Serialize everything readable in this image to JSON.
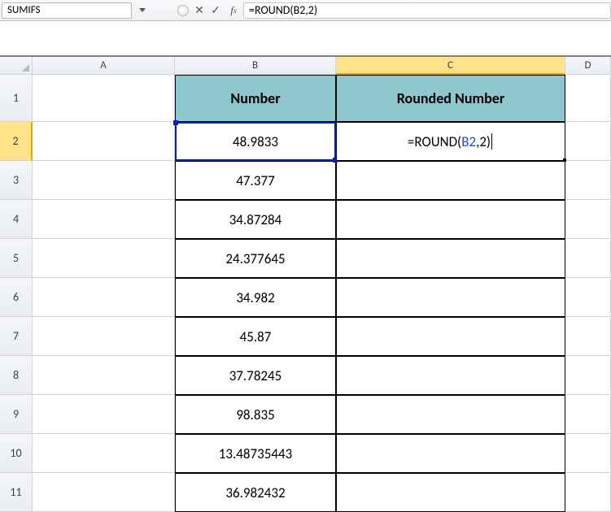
{
  "nameBox": "SUMIFS",
  "formulaBar": "=ROUND(B2,2)",
  "columns": [
    "A",
    "B",
    "C",
    "D"
  ],
  "rows": [
    "1",
    "2",
    "3",
    "4",
    "5",
    "6",
    "7",
    "8",
    "9",
    "10",
    "11"
  ],
  "headers": {
    "B1": "Number",
    "C1": "Rounded Number"
  },
  "editing": {
    "cell": "C2",
    "prefix": "=ROUND(",
    "ref": "B2",
    "suffix": ",2)"
  },
  "chart_data": {
    "type": "table",
    "title": "Number",
    "columns": [
      "Number",
      "Rounded Number"
    ],
    "rows": [
      {
        "Number": 48.9833,
        "Rounded Number": "=ROUND(B2,2)"
      },
      {
        "Number": 47.377,
        "Rounded Number": ""
      },
      {
        "Number": 34.87284,
        "Rounded Number": ""
      },
      {
        "Number": 24.377645,
        "Rounded Number": ""
      },
      {
        "Number": 34.982,
        "Rounded Number": ""
      },
      {
        "Number": 45.87,
        "Rounded Number": ""
      },
      {
        "Number": 37.78245,
        "Rounded Number": ""
      },
      {
        "Number": 98.835,
        "Rounded Number": ""
      },
      {
        "Number": 13.48735443,
        "Rounded Number": ""
      },
      {
        "Number": 36.982432,
        "Rounded Number": ""
      }
    ]
  }
}
